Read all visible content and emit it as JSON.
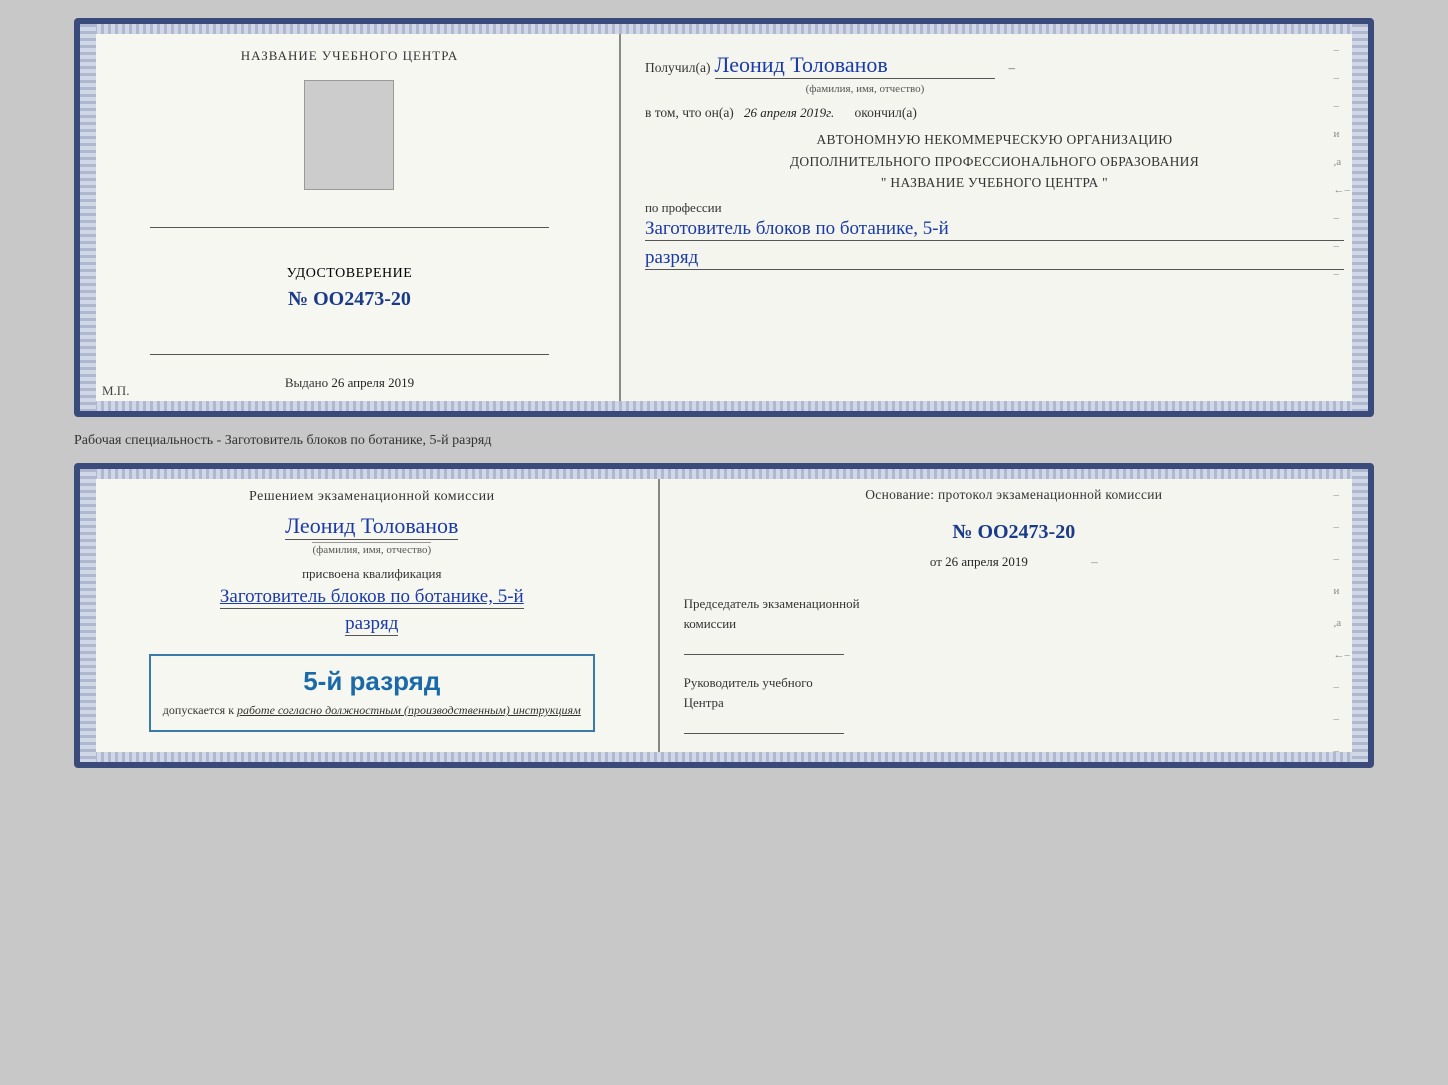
{
  "doc1": {
    "left": {
      "section_title": "НАЗВАНИЕ УЧЕБНОГО ЦЕНТРА",
      "cert_title": "УДОСТОВЕРЕНИЕ",
      "cert_number": "№ OO2473-20",
      "vydano_label": "Выдано",
      "vydano_date": "26 апреля 2019",
      "mp_label": "М.П."
    },
    "right": {
      "received_prefix": "Получил(а)",
      "received_name": "Леонид Толованов",
      "fio_label": "(фамилия, имя, отчество)",
      "vtom_text": "в том, что он(а)",
      "vtom_date": "26 апреля 2019г.",
      "okончил": "окончил(а)",
      "org_line1": "АВТОНОМНУЮ НЕКОММЕРЧЕСКУЮ ОРГАНИЗАЦИЮ",
      "org_line2": "ДОПОЛНИТЕЛЬНОГО ПРОФЕССИОНАЛЬНОГО ОБРАЗОВАНИЯ",
      "org_line3": "\"  НАЗВАНИЕ УЧЕБНОГО ЦЕНТРА  \"",
      "po_professii": "по профессии",
      "professiya": "Заготовитель блоков по ботанике, 5-й",
      "razryad": "разряд"
    }
  },
  "between_label": "Рабочая специальность - Заготовитель блоков по ботанике, 5-й разряд",
  "doc2": {
    "left": {
      "resheniem": "Решением экзаменационной комиссии",
      "person_name": "Леонид Толованов",
      "fio_label": "(фамилия, имя, отчество)",
      "prisvoyena": "присвоена квалификация",
      "kval": "Заготовитель блоков по ботанике, 5-й",
      "razryad": "разряд",
      "stamp_main": "5-й разряд",
      "stamp_dopusk": "допускается к",
      "stamp_italic": "работе согласно должностным (производственным) инструкциям"
    },
    "right": {
      "osnov_text": "Основание: протокол экзаменационной комиссии",
      "protocol_number": "№  OO2473-20",
      "ot_label": "от",
      "ot_date": "26 апреля 2019",
      "chairman_line1": "Председатель экзаменационной",
      "chairman_line2": "комиссии",
      "ruk_line1": "Руководитель учебного",
      "ruk_line2": "Центра"
    }
  }
}
